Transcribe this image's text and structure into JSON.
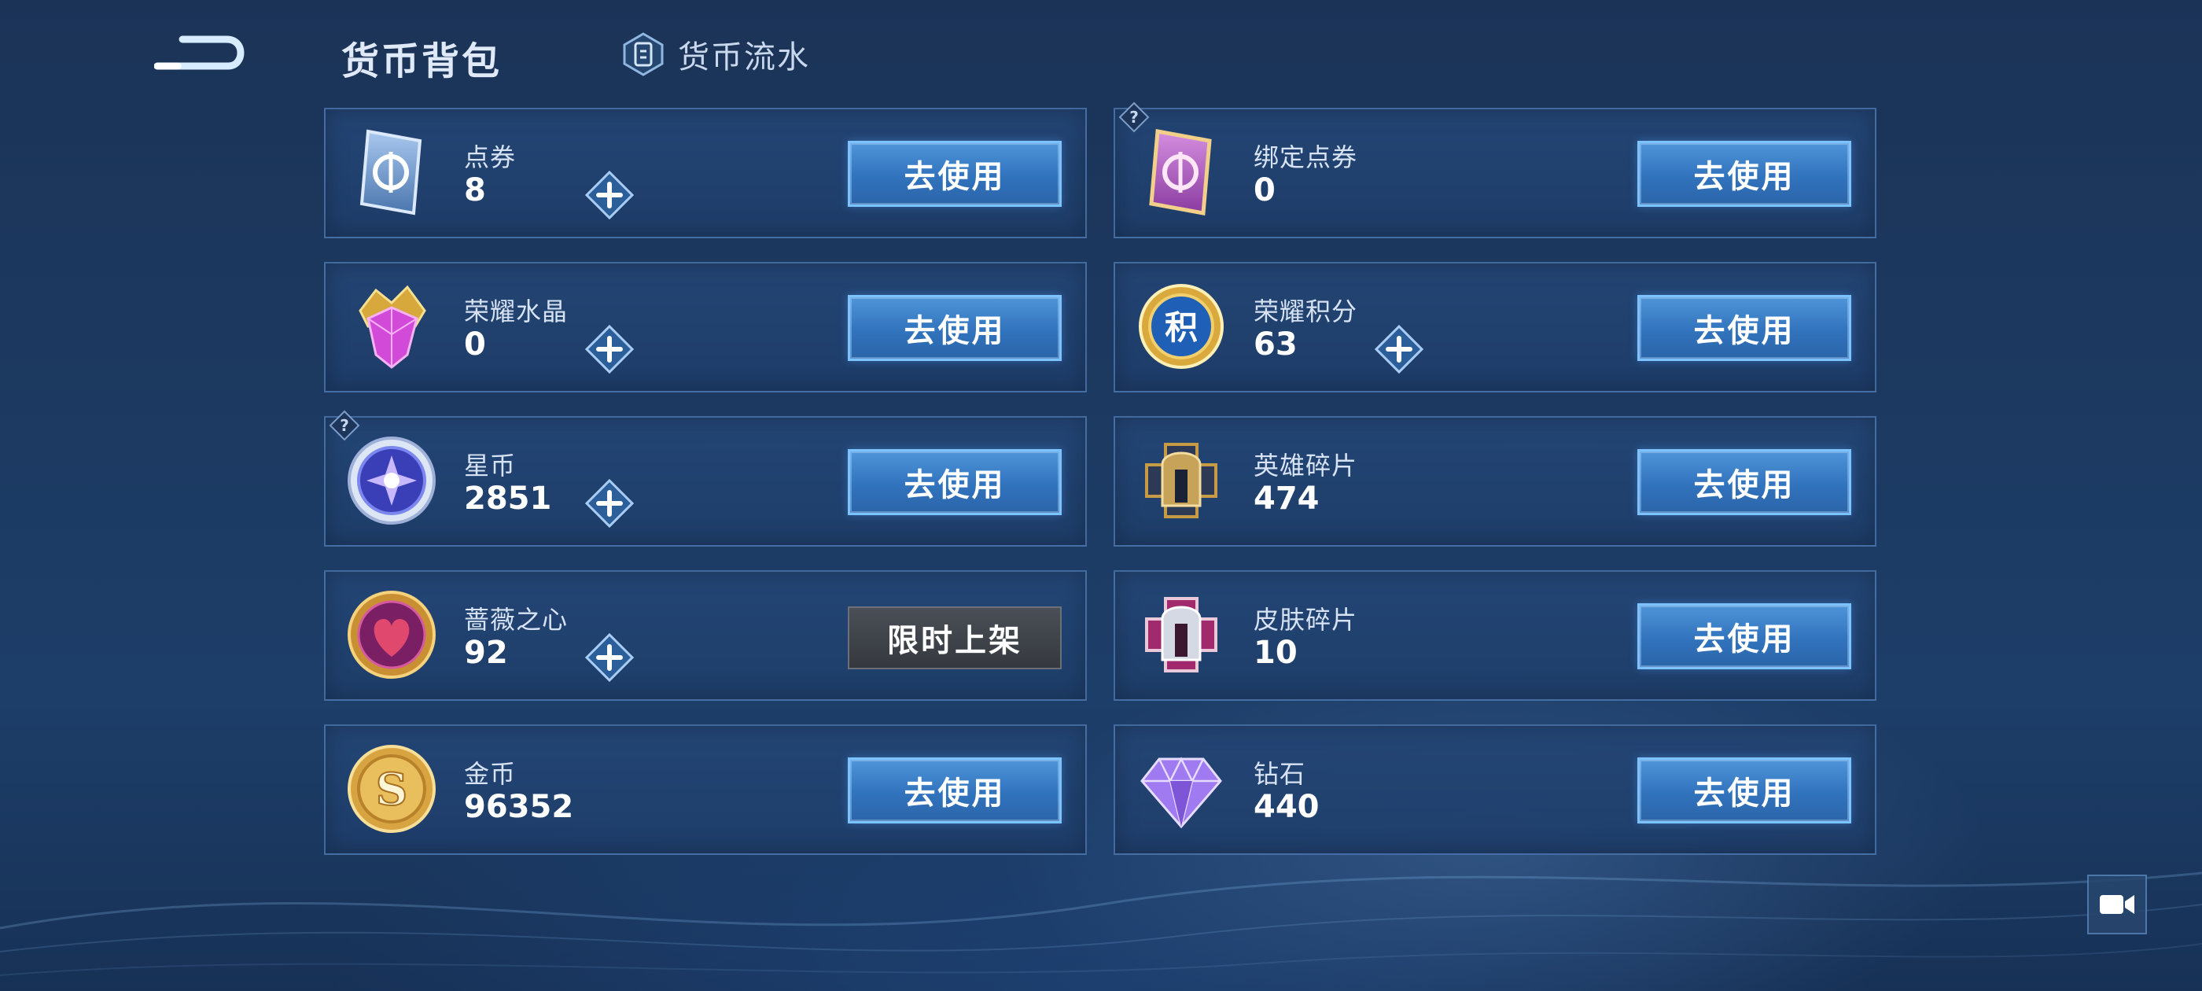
{
  "header": {
    "title": "货币背包",
    "flow_label": "货币流水"
  },
  "currencies": [
    {
      "name": "点券",
      "value": "8",
      "button": "去使用",
      "has_plus": true,
      "has_help": false,
      "icon": "ticket-icon"
    },
    {
      "name": "绑定点券",
      "value": "0",
      "button": "去使用",
      "has_plus": false,
      "has_help": true,
      "icon": "bound-ticket-icon"
    },
    {
      "name": "荣耀水晶",
      "value": "0",
      "button": "去使用",
      "has_plus": true,
      "has_help": false,
      "icon": "crystal-icon"
    },
    {
      "name": "荣耀积分",
      "value": "63",
      "button": "去使用",
      "has_plus": true,
      "has_help": false,
      "icon": "points-icon"
    },
    {
      "name": "星币",
      "value": "2851",
      "button": "去使用",
      "has_plus": true,
      "has_help": true,
      "icon": "star-coin-icon"
    },
    {
      "name": "英雄碎片",
      "value": "474",
      "button": "去使用",
      "has_plus": false,
      "has_help": false,
      "icon": "hero-fragment-icon"
    },
    {
      "name": "蔷薇之心",
      "value": "92",
      "button": "限时上架",
      "has_plus": true,
      "has_help": false,
      "icon": "rose-heart-icon"
    },
    {
      "name": "皮肤碎片",
      "value": "10",
      "button": "去使用",
      "has_plus": false,
      "has_help": false,
      "icon": "skin-fragment-icon"
    },
    {
      "name": "金币",
      "value": "96352",
      "button": "去使用",
      "has_plus": false,
      "has_help": false,
      "icon": "gold-coin-icon"
    },
    {
      "name": "钻石",
      "value": "440",
      "button": "去使用",
      "has_plus": false,
      "has_help": false,
      "icon": "diamond-icon"
    }
  ],
  "colors": {
    "button_blue": "#3173bd",
    "button_border": "#7cc2ff",
    "limited_gray": "#3f4349",
    "card_bg": "#244676"
  }
}
